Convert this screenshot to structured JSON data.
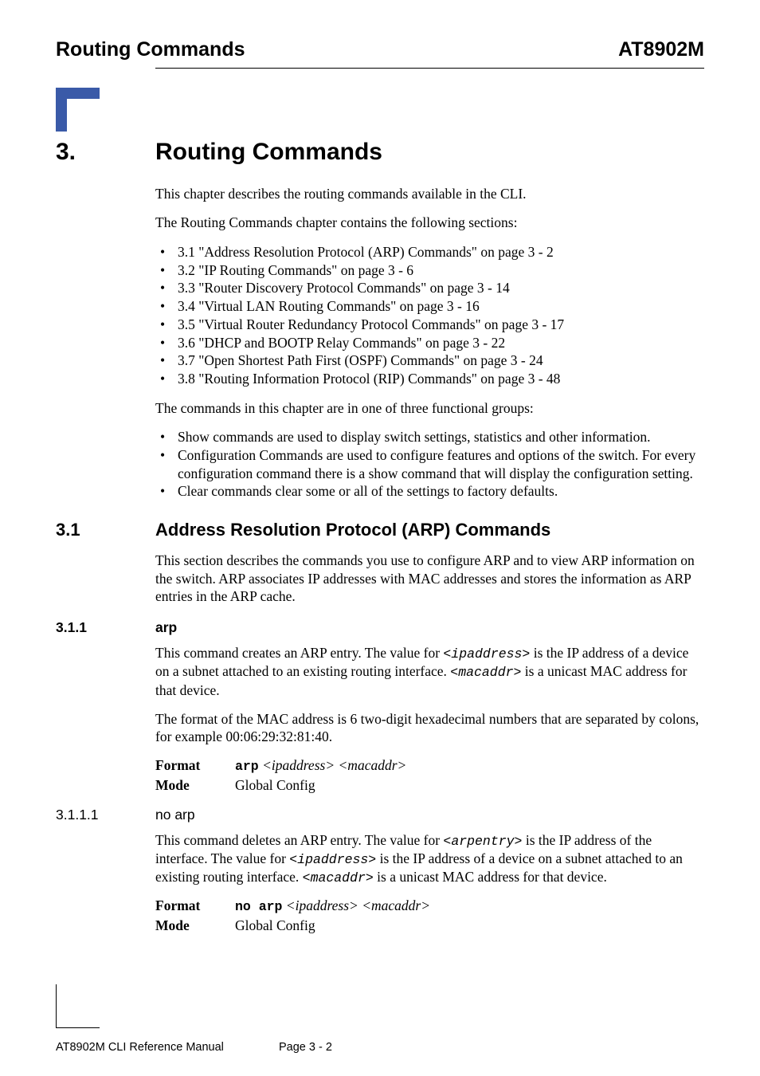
{
  "header": {
    "left": "Routing Commands",
    "right": "AT8902M"
  },
  "chapter": {
    "num": "3.",
    "title": "Routing Commands",
    "intro1": "This chapter describes the routing commands available in the CLI.",
    "intro2": "The Routing Commands chapter contains the following sections:"
  },
  "toc": [
    "3.1 \"Address Resolution Protocol (ARP) Commands\" on page 3 - 2",
    "3.2 \"IP Routing Commands\" on page 3 - 6",
    "3.3 \"Router Discovery Protocol Commands\" on page 3 - 14",
    "3.4 \"Virtual LAN Routing Commands\" on page 3 - 16",
    "3.5 \"Virtual Router Redundancy Protocol Commands\" on page 3 - 17",
    "3.6 \"DHCP and BOOTP Relay Commands\" on page 3 - 22",
    "3.7 \"Open Shortest Path First (OSPF) Commands\" on page 3 - 24",
    "3.8 \"Routing Information Protocol (RIP) Commands\" on page 3 - 48"
  ],
  "groups_intro": "The commands in this chapter are in one of three functional groups:",
  "groups": [
    "Show commands are used to display switch settings, statistics and other information.",
    "Configuration Commands are used to configure features and options of the switch. For every configuration command there is a show command that will display the configuration setting.",
    "Clear commands clear some or all of the settings to factory defaults."
  ],
  "s31": {
    "num": "3.1",
    "title": "Address Resolution Protocol (ARP) Commands",
    "desc": "This section describes the commands you use to configure ARP and to view ARP information on the switch. ARP associates IP addresses with MAC addresses and stores the information as ARP entries in the ARP cache."
  },
  "s311": {
    "num": "3.1.1",
    "title": "arp",
    "p1a": "This command creates an ARP entry. The value for ",
    "p1b": "<ipaddress>",
    "p1c": " is the IP address of a device on a subnet attached to an existing routing interface. ",
    "p1d": "<macaddr>",
    "p1e": " is a unicast MAC address for that device.",
    "p2": "The format of the MAC address is 6 two-digit hexadecimal numbers that are separated by colons, for example 00:06:29:32:81:40.",
    "format_label": "Format",
    "format_cmd": "arp",
    "format_args": " <ipaddress> <macaddr>",
    "mode_label": "Mode",
    "mode_value": "Global Config"
  },
  "s3111": {
    "num": "3.1.1.1",
    "title": "no arp",
    "p1a": "This command deletes an ARP entry. The value for ",
    "p1b": "<arpentry>",
    "p1c": " is the IP address of the interface. The value for ",
    "p1d": "<ipaddress>",
    "p1e": " is the IP address of a device on a subnet attached to an existing routing interface. ",
    "p1f": "<macaddr>",
    "p1g": " is a unicast MAC address for that device.",
    "format_label": "Format",
    "format_cmd": "no arp",
    "format_args": " <ipaddress> <macaddr>",
    "mode_label": "Mode",
    "mode_value": "Global Config"
  },
  "footer": {
    "left": "AT8902M CLI Reference Manual",
    "center": "Page 3 - 2"
  }
}
